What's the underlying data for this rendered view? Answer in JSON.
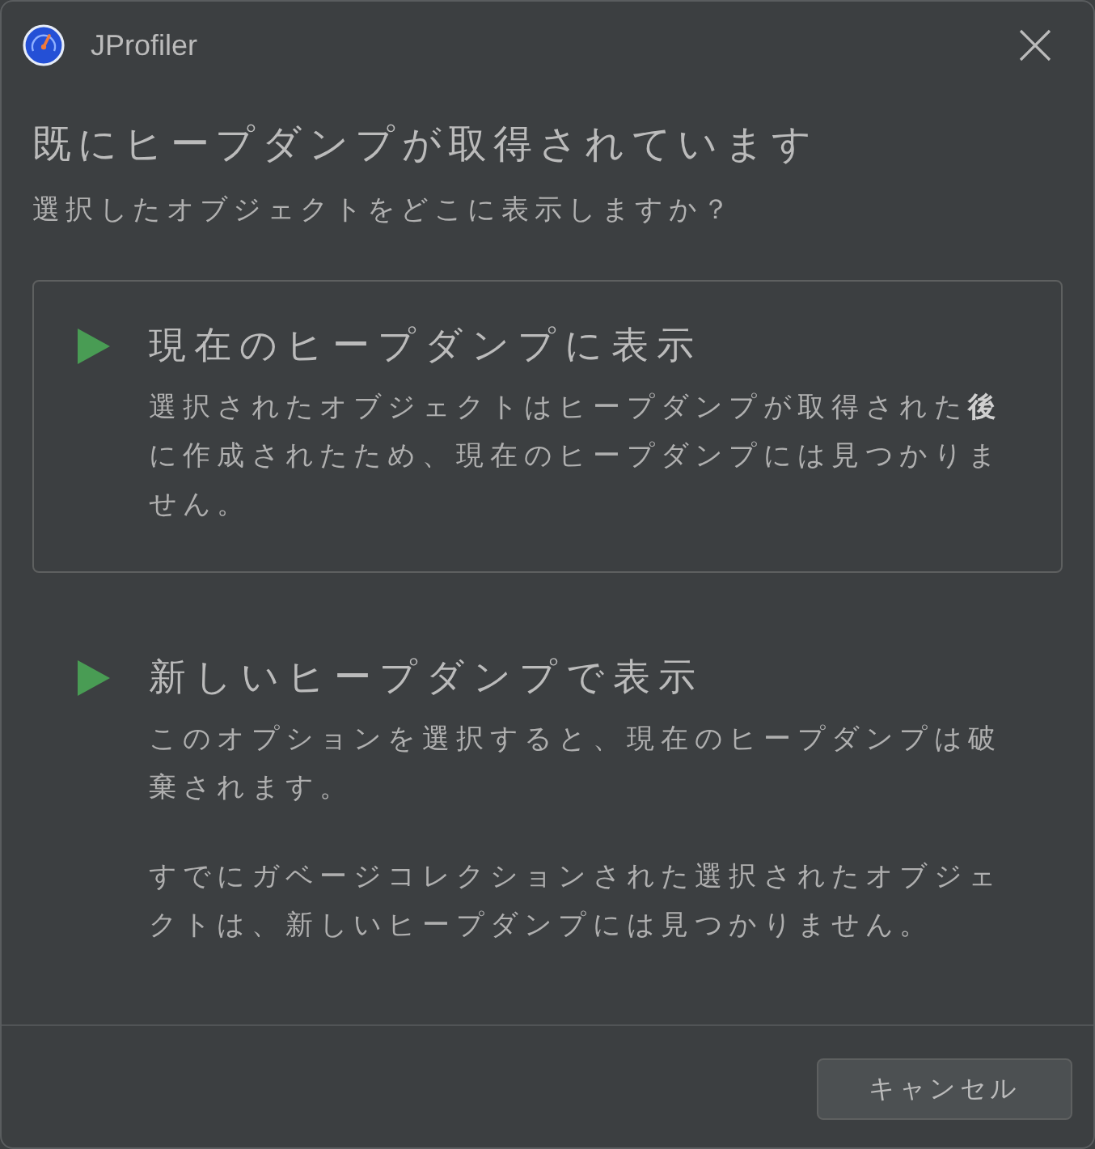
{
  "window": {
    "title": "JProfiler"
  },
  "heading": "既にヒープダンプが取得されています",
  "subtitle": "選択したオブジェクトをどこに表示しますか？",
  "options": [
    {
      "title": "現在のヒープダンプに表示",
      "selected": true,
      "description": [
        "選択されたオブジェクトはヒープダンプが取得された**後**に作成されたため、現在のヒープダンプには見つかりません。"
      ]
    },
    {
      "title": "新しいヒープダンプで表示",
      "selected": false,
      "description": [
        "このオプションを選択すると、現在のヒープダンプは破棄されます。",
        "すでにガベージコレクションされた選択されたオブジェクトは、新しいヒープダンプには見つかりません。"
      ]
    }
  ],
  "buttons": [
    {
      "label": "キャンセル"
    }
  ]
}
